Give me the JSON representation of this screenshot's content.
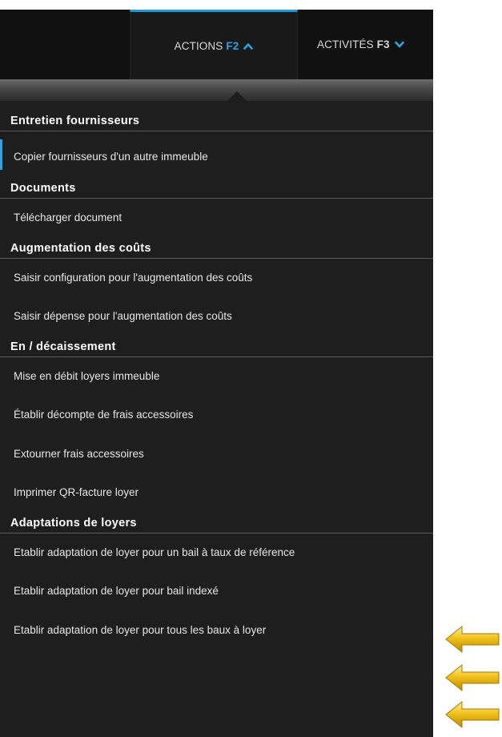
{
  "tabs": [
    {
      "label": "ACTIONS",
      "key": "F2",
      "chevron": "chevron-up-icon",
      "active": true
    },
    {
      "label": "ACTIVITÉS",
      "key": "F3",
      "chevron": "chevron-down-icon",
      "active": false
    }
  ],
  "accent_color": "#2ea3e0",
  "arrow_color": "#f2c21b",
  "sections": [
    {
      "title": "Entretien fournisseurs",
      "items": [
        "Copier fournisseurs d'un autre immeuble"
      ]
    },
    {
      "title": "Documents",
      "items": [
        "Télécharger document"
      ]
    },
    {
      "title": "Augmentation des coûts",
      "items": [
        "Saisir configuration pour l'augmentation des coûts",
        "Saisir dépense pour l'augmentation des coûts"
      ]
    },
    {
      "title": "En / décaissement",
      "items": [
        "Mise en débit loyers immeuble",
        "Établir décompte de frais accessoires",
        "Extourner frais accessoires",
        "Imprimer QR-facture loyer"
      ]
    },
    {
      "title": "Adaptations de loyers",
      "items": [
        "Etablir adaptation de loyer pour un bail à taux de référence",
        "Etablir adaptation de loyer pour bail indexé",
        "Etablir adaptation de loyer pour tous les baux à loyer"
      ]
    }
  ]
}
